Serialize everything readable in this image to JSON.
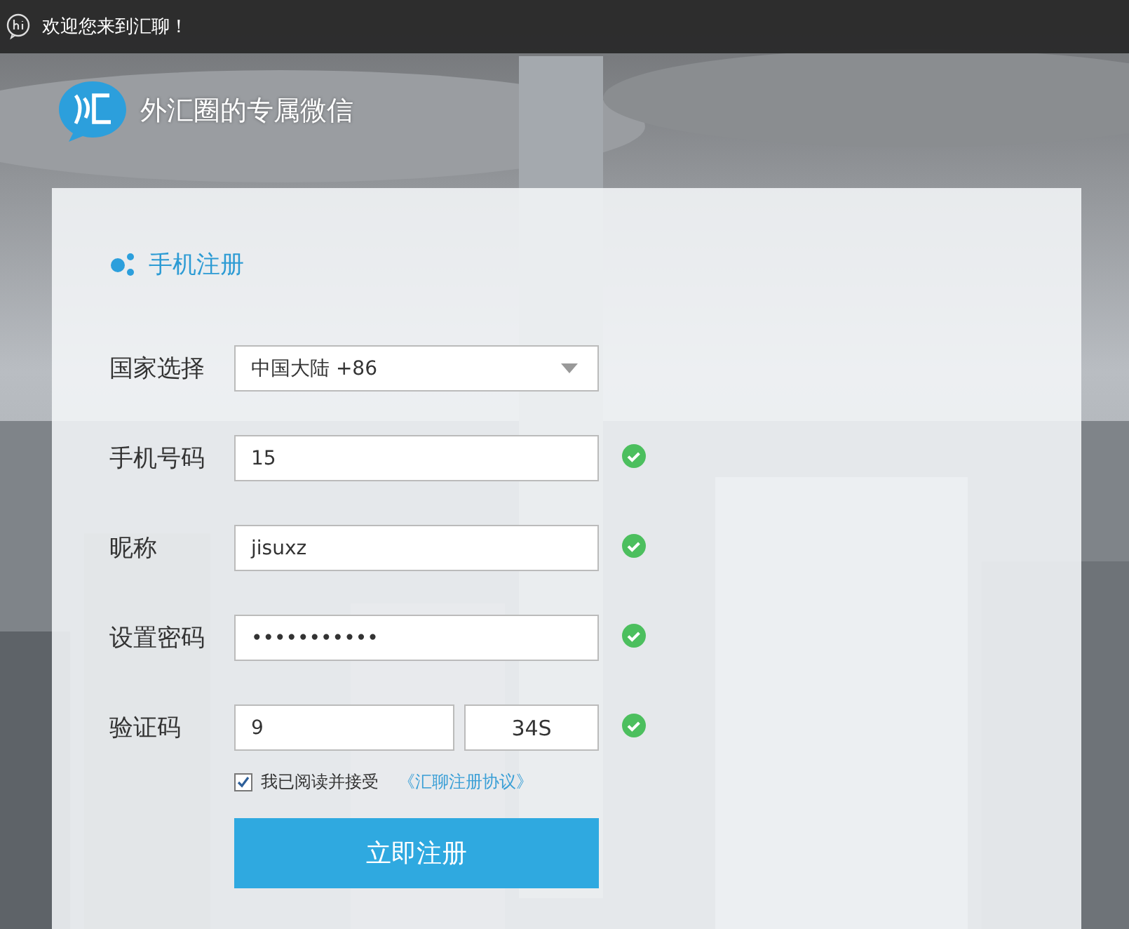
{
  "title_bar": {
    "text": "欢迎您来到汇聊！"
  },
  "header": {
    "slogan": "外汇圈的专属微信"
  },
  "form": {
    "title": "手机注册",
    "fields": [
      {
        "kind": "select",
        "label": "国家选择",
        "value": "中国大陆 +86"
      },
      {
        "kind": "text",
        "label": "手机号码",
        "value": "15",
        "valid": true
      },
      {
        "kind": "text",
        "label": "昵称",
        "value": "jisuxz",
        "valid": true
      },
      {
        "kind": "text",
        "label": "设置密码",
        "value": "•••••••••••",
        "valid": true
      },
      {
        "kind": "code",
        "label": "验证码",
        "value": "9",
        "countdown": "34S",
        "valid": true
      }
    ],
    "agreement": {
      "checked": true,
      "text": "我已阅读并接受",
      "link": "《汇聊注册协议》"
    },
    "submit_button": "立即注册"
  }
}
